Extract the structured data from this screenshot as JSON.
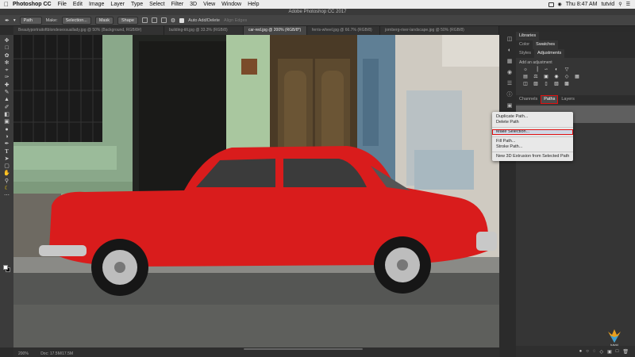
{
  "menubar": {
    "app": "Photoshop CC",
    "items": [
      "File",
      "Edit",
      "Image",
      "Layer",
      "Type",
      "Select",
      "Filter",
      "3D",
      "View",
      "Window",
      "Help"
    ],
    "clock": "Thu 8:47 AM",
    "user": "tutvid"
  },
  "window_title": "Adobe Photoshop CC 2017",
  "options": {
    "mode_value": "Path",
    "make_label": "Make:",
    "selection_button": "Selection...",
    "mask_button": "Mask",
    "shape_button": "Shape",
    "auto_add_delete": "Auto Add/Delete",
    "align_edges": "Align Edges"
  },
  "tabs": [
    "Beautyportraitoftblondesexsuallady.jpg @ 50% (Background, RGB/8#)",
    "building-tilt.jpg @ 33.3% (RGB/8)",
    "car-red.jpg @ 200% (RGB/8*)",
    "ferris-wheel.jpg @ 66.7% (RGB/8)",
    "jornberg-river-landscape.jpg @ 50% (RGB/8)"
  ],
  "active_tab_index": 2,
  "panel": {
    "top_tabs": [
      "Libraries"
    ],
    "second_tabs": [
      "Color",
      "Swatches"
    ],
    "third_tabs": [
      "Styles",
      "Adjustments"
    ],
    "adjustments_title": "Add an adjustment",
    "bottom_tabs": [
      "Channels",
      "Paths",
      "Layers"
    ]
  },
  "context_menu": {
    "items": [
      "Duplicate Path...",
      "Delete Path",
      "Make Selection...",
      "Fill Path...",
      "Stroke Path...",
      "New 3D Extrusion from Selected Path"
    ],
    "highlighted": "Make Selection..."
  },
  "status": {
    "zoom": "200%",
    "doc": "Doc: 17.5M/17.5M"
  },
  "logo_text": "tutvid",
  "colors": {
    "accent": "#e01010",
    "car": "#d91c1c"
  }
}
